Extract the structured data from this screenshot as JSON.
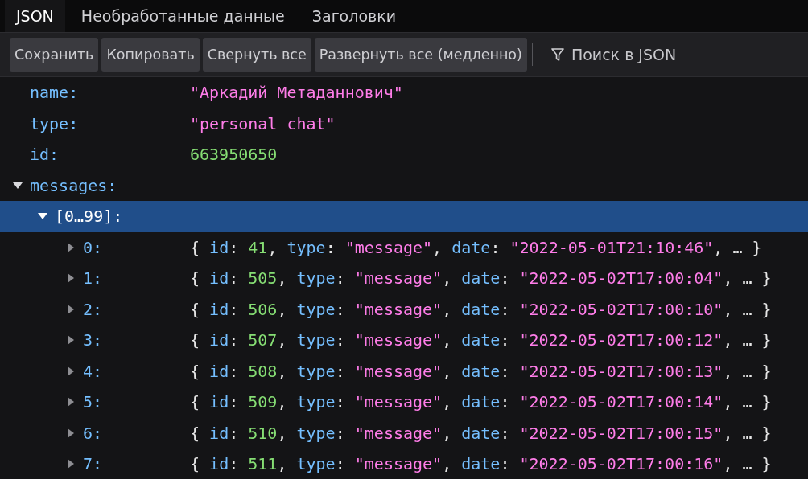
{
  "tabs": [
    {
      "label": "JSON",
      "selected": true
    },
    {
      "label": "Необработанные данные",
      "selected": false
    },
    {
      "label": "Заголовки",
      "selected": false
    }
  ],
  "toolbar": {
    "buttons": [
      "Сохранить",
      "Копировать",
      "Свернуть все",
      "Развернуть все (медленно)"
    ],
    "filter": {
      "placeholder": "Поиск в JSON"
    }
  },
  "tree": [
    {
      "key": "name:",
      "selected": false,
      "value": [
        {
          "kind": "string",
          "text": "\"Аркадий Метаданнович\""
        }
      ]
    },
    {
      "key": "type:",
      "selected": false,
      "value": [
        {
          "kind": "string",
          "text": "\"personal_chat\""
        }
      ]
    },
    {
      "key": "id:",
      "selected": false,
      "value": [
        {
          "kind": "number",
          "text": "663950650"
        }
      ]
    },
    {
      "key": "messages:",
      "selected": false,
      "expanded": true,
      "children": [
        {
          "key": "[0…99]:",
          "selected": true,
          "expanded": true,
          "children": [
            {
              "key": "0:",
              "selected": false,
              "expanded": false,
              "value": [
                {
                  "kind": "punct",
                  "text": "{ "
                },
                {
                  "kind": "key",
                  "text": "id"
                },
                {
                  "kind": "punct",
                  "text": ": "
                },
                {
                  "kind": "number",
                  "text": "41"
                },
                {
                  "kind": "punct",
                  "text": ", "
                },
                {
                  "kind": "key",
                  "text": "type"
                },
                {
                  "kind": "punct",
                  "text": ": "
                },
                {
                  "kind": "string",
                  "text": "\"message\""
                },
                {
                  "kind": "punct",
                  "text": ", "
                },
                {
                  "kind": "key",
                  "text": "date"
                },
                {
                  "kind": "punct",
                  "text": ": "
                },
                {
                  "kind": "string",
                  "text": "\"2022-05-01T21:10:46\""
                },
                {
                  "kind": "punct",
                  "text": ", … }"
                }
              ]
            },
            {
              "key": "1:",
              "selected": false,
              "expanded": false,
              "value": [
                {
                  "kind": "punct",
                  "text": "{ "
                },
                {
                  "kind": "key",
                  "text": "id"
                },
                {
                  "kind": "punct",
                  "text": ": "
                },
                {
                  "kind": "number",
                  "text": "505"
                },
                {
                  "kind": "punct",
                  "text": ", "
                },
                {
                  "kind": "key",
                  "text": "type"
                },
                {
                  "kind": "punct",
                  "text": ": "
                },
                {
                  "kind": "string",
                  "text": "\"message\""
                },
                {
                  "kind": "punct",
                  "text": ", "
                },
                {
                  "kind": "key",
                  "text": "date"
                },
                {
                  "kind": "punct",
                  "text": ": "
                },
                {
                  "kind": "string",
                  "text": "\"2022-05-02T17:00:04\""
                },
                {
                  "kind": "punct",
                  "text": ", … }"
                }
              ]
            },
            {
              "key": "2:",
              "selected": false,
              "expanded": false,
              "value": [
                {
                  "kind": "punct",
                  "text": "{ "
                },
                {
                  "kind": "key",
                  "text": "id"
                },
                {
                  "kind": "punct",
                  "text": ": "
                },
                {
                  "kind": "number",
                  "text": "506"
                },
                {
                  "kind": "punct",
                  "text": ", "
                },
                {
                  "kind": "key",
                  "text": "type"
                },
                {
                  "kind": "punct",
                  "text": ": "
                },
                {
                  "kind": "string",
                  "text": "\"message\""
                },
                {
                  "kind": "punct",
                  "text": ", "
                },
                {
                  "kind": "key",
                  "text": "date"
                },
                {
                  "kind": "punct",
                  "text": ": "
                },
                {
                  "kind": "string",
                  "text": "\"2022-05-02T17:00:10\""
                },
                {
                  "kind": "punct",
                  "text": ", … }"
                }
              ]
            },
            {
              "key": "3:",
              "selected": false,
              "expanded": false,
              "value": [
                {
                  "kind": "punct",
                  "text": "{ "
                },
                {
                  "kind": "key",
                  "text": "id"
                },
                {
                  "kind": "punct",
                  "text": ": "
                },
                {
                  "kind": "number",
                  "text": "507"
                },
                {
                  "kind": "punct",
                  "text": ", "
                },
                {
                  "kind": "key",
                  "text": "type"
                },
                {
                  "kind": "punct",
                  "text": ": "
                },
                {
                  "kind": "string",
                  "text": "\"message\""
                },
                {
                  "kind": "punct",
                  "text": ", "
                },
                {
                  "kind": "key",
                  "text": "date"
                },
                {
                  "kind": "punct",
                  "text": ": "
                },
                {
                  "kind": "string",
                  "text": "\"2022-05-02T17:00:12\""
                },
                {
                  "kind": "punct",
                  "text": ", … }"
                }
              ]
            },
            {
              "key": "4:",
              "selected": false,
              "expanded": false,
              "value": [
                {
                  "kind": "punct",
                  "text": "{ "
                },
                {
                  "kind": "key",
                  "text": "id"
                },
                {
                  "kind": "punct",
                  "text": ": "
                },
                {
                  "kind": "number",
                  "text": "508"
                },
                {
                  "kind": "punct",
                  "text": ", "
                },
                {
                  "kind": "key",
                  "text": "type"
                },
                {
                  "kind": "punct",
                  "text": ": "
                },
                {
                  "kind": "string",
                  "text": "\"message\""
                },
                {
                  "kind": "punct",
                  "text": ", "
                },
                {
                  "kind": "key",
                  "text": "date"
                },
                {
                  "kind": "punct",
                  "text": ": "
                },
                {
                  "kind": "string",
                  "text": "\"2022-05-02T17:00:13\""
                },
                {
                  "kind": "punct",
                  "text": ", … }"
                }
              ]
            },
            {
              "key": "5:",
              "selected": false,
              "expanded": false,
              "value": [
                {
                  "kind": "punct",
                  "text": "{ "
                },
                {
                  "kind": "key",
                  "text": "id"
                },
                {
                  "kind": "punct",
                  "text": ": "
                },
                {
                  "kind": "number",
                  "text": "509"
                },
                {
                  "kind": "punct",
                  "text": ", "
                },
                {
                  "kind": "key",
                  "text": "type"
                },
                {
                  "kind": "punct",
                  "text": ": "
                },
                {
                  "kind": "string",
                  "text": "\"message\""
                },
                {
                  "kind": "punct",
                  "text": ", "
                },
                {
                  "kind": "key",
                  "text": "date"
                },
                {
                  "kind": "punct",
                  "text": ": "
                },
                {
                  "kind": "string",
                  "text": "\"2022-05-02T17:00:14\""
                },
                {
                  "kind": "punct",
                  "text": ", … }"
                }
              ]
            },
            {
              "key": "6:",
              "selected": false,
              "expanded": false,
              "value": [
                {
                  "kind": "punct",
                  "text": "{ "
                },
                {
                  "kind": "key",
                  "text": "id"
                },
                {
                  "kind": "punct",
                  "text": ": "
                },
                {
                  "kind": "number",
                  "text": "510"
                },
                {
                  "kind": "punct",
                  "text": ", "
                },
                {
                  "kind": "key",
                  "text": "type"
                },
                {
                  "kind": "punct",
                  "text": ": "
                },
                {
                  "kind": "string",
                  "text": "\"message\""
                },
                {
                  "kind": "punct",
                  "text": ", "
                },
                {
                  "kind": "key",
                  "text": "date"
                },
                {
                  "kind": "punct",
                  "text": ": "
                },
                {
                  "kind": "string",
                  "text": "\"2022-05-02T17:00:15\""
                },
                {
                  "kind": "punct",
                  "text": ", … }"
                }
              ]
            },
            {
              "key": "7:",
              "selected": false,
              "expanded": false,
              "value": [
                {
                  "kind": "punct",
                  "text": "{ "
                },
                {
                  "kind": "key",
                  "text": "id"
                },
                {
                  "kind": "punct",
                  "text": ": "
                },
                {
                  "kind": "number",
                  "text": "511"
                },
                {
                  "kind": "punct",
                  "text": ", "
                },
                {
                  "kind": "key",
                  "text": "type"
                },
                {
                  "kind": "punct",
                  "text": ": "
                },
                {
                  "kind": "string",
                  "text": "\"message\""
                },
                {
                  "kind": "punct",
                  "text": ", "
                },
                {
                  "kind": "key",
                  "text": "date"
                },
                {
                  "kind": "punct",
                  "text": ": "
                },
                {
                  "kind": "string",
                  "text": "\"2022-05-02T17:00:16\""
                },
                {
                  "kind": "punct",
                  "text": ", … }"
                }
              ]
            }
          ]
        }
      ]
    }
  ]
}
